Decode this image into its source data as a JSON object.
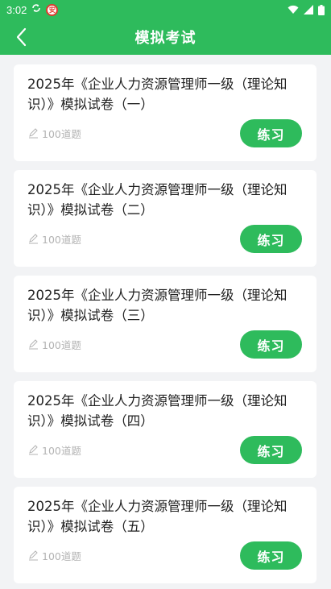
{
  "status": {
    "time": "3:02",
    "badge": "安"
  },
  "header": {
    "title": "模拟考试"
  },
  "papers": [
    {
      "title": "2025年《企业人力资源管理师一级（理论知识）》模拟试卷（一）",
      "count": "100道题",
      "action": "练习"
    },
    {
      "title": "2025年《企业人力资源管理师一级（理论知识）》模拟试卷（二）",
      "count": "100道题",
      "action": "练习"
    },
    {
      "title": "2025年《企业人力资源管理师一级（理论知识）》模拟试卷（三）",
      "count": "100道题",
      "action": "练习"
    },
    {
      "title": "2025年《企业人力资源管理师一级（理论知识）》模拟试卷（四）",
      "count": "100道题",
      "action": "练习"
    },
    {
      "title": "2025年《企业人力资源管理师一级（理论知识）》模拟试卷（五）",
      "count": "100道题",
      "action": "练习"
    }
  ],
  "theme": {
    "primary": "#2ebb5c",
    "background": "#f2f3f5"
  }
}
